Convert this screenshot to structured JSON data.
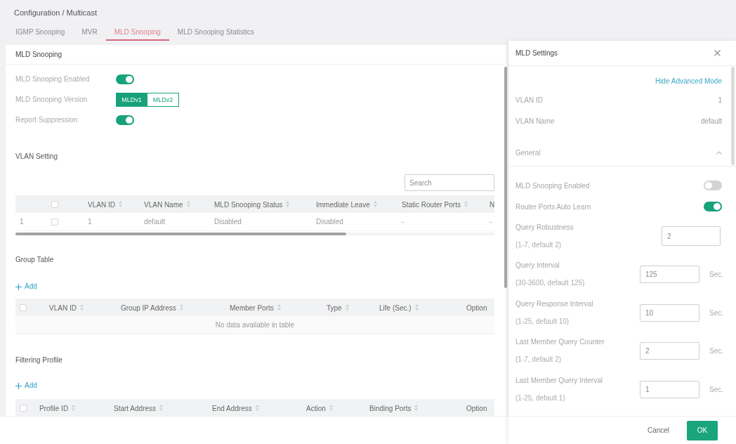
{
  "breadcrumb": "Configuration / Multicast",
  "tabs": [
    {
      "label": "IGMP Snooping",
      "selected": false
    },
    {
      "label": "MVR",
      "selected": false
    },
    {
      "label": "MLD Snooping",
      "selected": true
    },
    {
      "label": "MLD Snooping Statistics",
      "selected": false
    }
  ],
  "mld_snooping": {
    "title": "MLD Snooping",
    "settings": [
      {
        "kind": "toggle",
        "label": "MLD Snooping Enabled",
        "on": true
      },
      {
        "kind": "segmented",
        "label": "MLD Snooping Version",
        "options": [
          {
            "label": "MLDv1",
            "selected": true
          },
          {
            "label": "MLDv2",
            "selected": false
          }
        ]
      },
      {
        "kind": "toggle",
        "label": "Report Suppression",
        "on": true
      }
    ]
  },
  "vlan_setting": {
    "title": "VLAN Setting",
    "search": {
      "placeholder": "Search"
    },
    "select_all": {
      "checked": false
    },
    "columns": [
      {
        "label": "VLAN ID",
        "sortable": true
      },
      {
        "label": "VLAN Name",
        "sortable": true
      },
      {
        "label": "MLD Snooping Status",
        "sortable": true
      },
      {
        "label": "Immediate Leave",
        "sortable": true
      },
      {
        "label": "Static Router Ports",
        "sortable": true
      },
      {
        "label": "N",
        "sortable": false
      }
    ],
    "rows": [
      {
        "index": "1",
        "checked": false,
        "cells": [
          "1",
          "default",
          "Disabled",
          "Disabled",
          "-",
          "-"
        ]
      }
    ]
  },
  "group_table": {
    "title": "Group Table",
    "add_label": "Add",
    "select_all": {
      "checked": false
    },
    "columns": [
      {
        "label": "VLAN ID",
        "sortable": true
      },
      {
        "label": "Group IP Address",
        "sortable": true
      },
      {
        "label": "Member Ports",
        "sortable": true
      },
      {
        "label": "Type",
        "sortable": true
      },
      {
        "label": "Life (Sec.)",
        "sortable": true
      },
      {
        "label": "Option",
        "sortable": false
      }
    ],
    "empty_message": "No data available in table"
  },
  "filtering_profile": {
    "title": "Filtering Profile",
    "add_label": "Add",
    "select_all": {
      "checked": false
    },
    "columns": [
      {
        "label": "Profile ID",
        "sortable": true
      },
      {
        "label": "Start Address",
        "sortable": true
      },
      {
        "label": "End Address",
        "sortable": true
      },
      {
        "label": "Action",
        "sortable": true
      },
      {
        "label": "Binding Ports",
        "sortable": true
      },
      {
        "label": "Option",
        "sortable": false
      }
    ]
  },
  "drawer": {
    "title": "MLD Settings",
    "mode_link": "Hide Advanced Mode",
    "info": [
      {
        "label": "VLAN ID",
        "value": "1"
      },
      {
        "label": "VLAN Name",
        "value": "default"
      }
    ],
    "section": {
      "title": "General",
      "expanded": true
    },
    "fields": [
      {
        "kind": "toggle",
        "label": "MLD Snooping Enabled",
        "on": false
      },
      {
        "kind": "toggle",
        "label": "Router Ports Auto Learn",
        "on": true
      },
      {
        "kind": "number",
        "label": "Query Robustness",
        "hint": "(1-7, default 2)",
        "value": "2"
      },
      {
        "kind": "number",
        "label": "Query Interval",
        "hint": "(30-3600, default 125)",
        "value": "125",
        "unit": "Sec."
      },
      {
        "kind": "number",
        "label": "Query Response Interval",
        "hint": "(1-25, default 10)",
        "value": "10",
        "unit": "Sec."
      },
      {
        "kind": "number",
        "label": "Last Member Query Counter",
        "hint": "(1-7, default 2)",
        "value": "2",
        "unit": "Sec."
      },
      {
        "kind": "number",
        "label": "Last Member Query Interval",
        "hint": "(1-25, default 1)",
        "value": "1",
        "unit": "Sec."
      }
    ],
    "buttons": [
      {
        "label": "Cancel",
        "kind": "secondary"
      },
      {
        "label": "OK",
        "kind": "primary"
      }
    ]
  }
}
